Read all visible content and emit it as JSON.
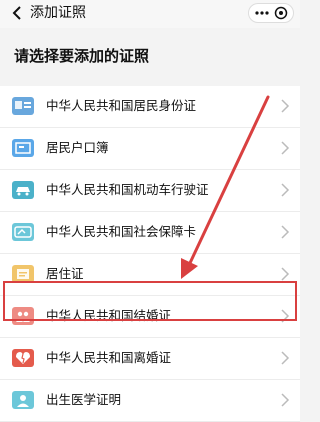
{
  "header": {
    "title": "添加证照",
    "back_icon": "chevron-left-icon",
    "more_icon": "ellipsis-icon",
    "close_icon": "close-circle-icon"
  },
  "section": {
    "title": "请选择要添加的证照"
  },
  "items": [
    {
      "label": "中华人民共和国居民身份证",
      "icon": "id-card-icon"
    },
    {
      "label": "居民户口簿",
      "icon": "household-register-icon"
    },
    {
      "label": "中华人民共和国机动车行驶证",
      "icon": "car-icon"
    },
    {
      "label": "中华人民共和国社会保障卡",
      "icon": "social-security-card-icon"
    },
    {
      "label": "居住证",
      "icon": "residence-permit-icon"
    },
    {
      "label": "中华人民共和国结婚证",
      "icon": "marriage-certificate-icon"
    },
    {
      "label": "中华人民共和国离婚证",
      "icon": "divorce-certificate-icon"
    },
    {
      "label": "出生医学证明",
      "icon": "birth-certificate-icon"
    }
  ],
  "highlighted_item": "中华人民共和国结婚证",
  "colors": {
    "highlight": "#d94040",
    "arrow": "#d94040"
  }
}
